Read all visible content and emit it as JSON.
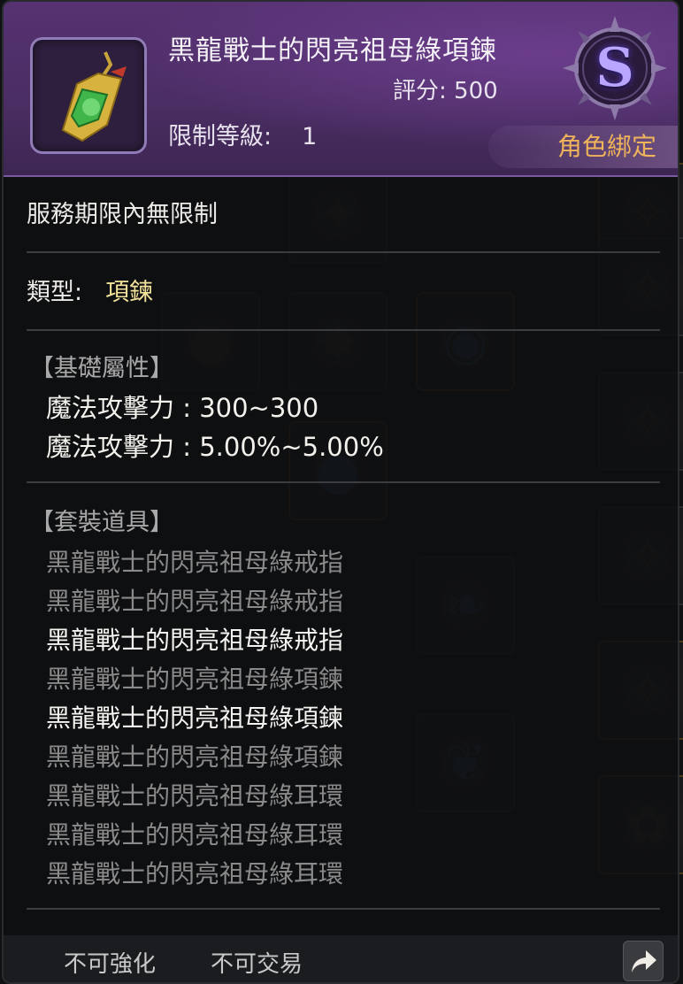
{
  "item": {
    "name": "黑龍戰士的閃亮祖母綠項鍊",
    "score_label": "評分: 500",
    "level_label": "限制等級:",
    "level_value": "1",
    "grade": "S",
    "bind": "角色綁定",
    "icon": "emerald-necklace-icon"
  },
  "details": {
    "period": "服務期限內無限制",
    "type_label": "類型:",
    "type_value": "項鍊"
  },
  "base_attributes": {
    "title": "【基礎屬性】",
    "lines": [
      "魔法攻擊力 : 300~300",
      "魔法攻擊力 : 5.00%~5.00%"
    ]
  },
  "set_items": {
    "title": "【套裝道具】",
    "items": [
      {
        "name": "黑龍戰士的閃亮祖母綠戒指",
        "active": false
      },
      {
        "name": "黑龍戰士的閃亮祖母綠戒指",
        "active": false
      },
      {
        "name": "黑龍戰士的閃亮祖母綠戒指",
        "active": true
      },
      {
        "name": "黑龍戰士的閃亮祖母綠項鍊",
        "active": false
      },
      {
        "name": "黑龍戰士的閃亮祖母綠項鍊",
        "active": true
      },
      {
        "name": "黑龍戰士的閃亮祖母綠項鍊",
        "active": false
      },
      {
        "name": "黑龍戰士的閃亮祖母綠耳環",
        "active": false
      },
      {
        "name": "黑龍戰士的閃亮祖母綠耳環",
        "active": false
      },
      {
        "name": "黑龍戰士的閃亮祖母綠耳環",
        "active": false
      }
    ]
  },
  "footer": {
    "flags": [
      "不可強化",
      "不可交易"
    ],
    "share_icon": "share-arrow-icon"
  },
  "colors": {
    "header_purple": "#563272",
    "bind_orange": "#f0b45a",
    "type_yellow": "#f2e29a",
    "set_dim": "#8a8a8a"
  }
}
